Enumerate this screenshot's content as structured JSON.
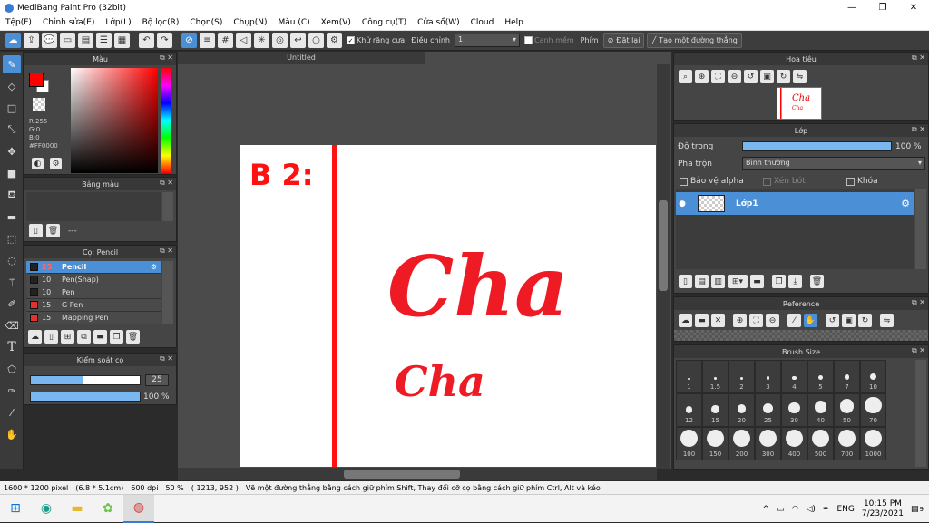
{
  "window": {
    "title": "MediBang Paint Pro (32bit)",
    "minimize": "—",
    "restore": "❐",
    "close": "✕"
  },
  "menu": [
    "Tệp(F)",
    "Chỉnh sửa(E)",
    "Lớp(L)",
    "Bộ lọc(R)",
    "Chọn(S)",
    "Chụp(N)",
    "Màu (C)",
    "Xem(V)",
    "Công cụ(T)",
    "Cửa sổ(W)",
    "Cloud",
    "Help"
  ],
  "toolbar": {
    "antialias_label": "Khử răng cưa",
    "adjust_label": "Điều chỉnh",
    "adjust_value": "1",
    "snap_label": "Canh mềm",
    "key_label": "Phím",
    "reset_label": "Đặt lại",
    "straight_line_label": "Tạo một đường thẳng"
  },
  "color_panel": {
    "title": "Màu",
    "primary_color": "#FF0000",
    "r": "R:255",
    "g": "G:0",
    "b": "B:0",
    "hex": "#FF0000"
  },
  "palette_panel": {
    "title": "Bảng màu",
    "dash": "---"
  },
  "brush_panel": {
    "title": "Cọ: Pencil",
    "brushes": [
      {
        "size": "25",
        "name": "Pencil",
        "color": "#222222"
      },
      {
        "size": "10",
        "name": "Pen(Shap)",
        "color": "#222222"
      },
      {
        "size": "10",
        "name": "Pen",
        "color": "#222222"
      },
      {
        "size": "15",
        "name": "G Pen",
        "color": "#e53030"
      },
      {
        "size": "15",
        "name": "Mapping Pen",
        "color": "#e53030"
      }
    ]
  },
  "brush_control": {
    "title": "Kiểm soát cọ",
    "size_value": "25",
    "size_fraction": 0.48,
    "opacity_value": "100 %",
    "opacity_fraction": 1.0
  },
  "canvas": {
    "tab_title": "Untitled",
    "text_b2": "B 2:",
    "text_cha_large": "Cha",
    "text_cha_small": "Cha"
  },
  "navigator": {
    "title": "Hoa tiêu"
  },
  "layer_panel": {
    "title": "Lớp",
    "opacity_label": "Độ trong",
    "opacity_value": "100 %",
    "opacity_fraction": 1.0,
    "blend_label": "Pha trộn",
    "blend_value": "Bình thường",
    "protect_alpha": "Bảo vệ alpha",
    "clip": "Xén bớt",
    "lock": "Khóa",
    "layer_name": "Lớp1"
  },
  "reference_panel": {
    "title": "Reference"
  },
  "brushsize_panel": {
    "title": "Brush Size",
    "sizes": [
      "1",
      "1.5",
      "2",
      "3",
      "4",
      "5",
      "7",
      "10",
      "12",
      "15",
      "20",
      "25",
      "30",
      "40",
      "50",
      "70",
      "100",
      "150",
      "200",
      "300",
      "400",
      "500",
      "700",
      "1000"
    ]
  },
  "status": {
    "dims": "1600 * 1200 pixel",
    "cm": "(6.8 * 5.1cm)",
    "dpi": "600 dpi",
    "zoom": "50 %",
    "coords": "( 1213, 952 )",
    "hint": "Vẽ một đường thẳng bằng cách giữ phím Shift, Thay đổi cỡ cọ bằng cách giữ phím Ctrl, Alt và kéo"
  },
  "taskbar": {
    "lang": "ENG",
    "time": "10:15 PM",
    "date": "7/23/2021",
    "notif": "9"
  }
}
